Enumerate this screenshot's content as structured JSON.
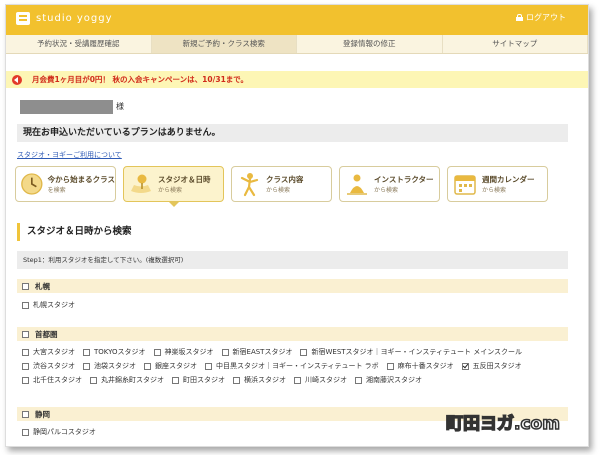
{
  "header": {
    "brand": "studio yoggy",
    "logout_label": "ログアウト"
  },
  "nav": {
    "items": [
      {
        "label": "予約状況・受講履歴確認"
      },
      {
        "label": "新規ご予約・クラス検索"
      },
      {
        "label": "登録情報の修正"
      },
      {
        "label": "サイトマップ"
      }
    ]
  },
  "promo": {
    "text": "月会費1ヶ月目が0円！ 秋の入会キャンペーンは、10/31まで。"
  },
  "user": {
    "honorific": "様"
  },
  "status": {
    "no_plan": "現在お申込いただいているプランはありません。"
  },
  "guide_link": "スタジオ・ヨギーご利用について",
  "search_tabs": [
    {
      "title": "今から始まるクラス",
      "sub": "を検索"
    },
    {
      "title": "スタジオ＆日時",
      "sub": "から検索"
    },
    {
      "title": "クラス内容",
      "sub": "から検索"
    },
    {
      "title": "インストラクター",
      "sub": "から検索"
    },
    {
      "title": "週間カレンダー",
      "sub": "から検索"
    }
  ],
  "section": {
    "title": "スタジオ＆日時から検索",
    "step1": "Step1：利用スタジオを指定して下さい。(複数選択可)"
  },
  "regions": [
    {
      "name": "札幌",
      "studios": [
        {
          "label": "札幌スタジオ",
          "checked": false
        }
      ]
    },
    {
      "name": "首都圏",
      "studios": [
        {
          "label": "大宮スタジオ",
          "checked": false
        },
        {
          "label": "TOKYOスタジオ",
          "checked": false
        },
        {
          "label": "神楽坂スタジオ",
          "checked": false
        },
        {
          "label": "新宿EASTスタジオ",
          "checked": false
        },
        {
          "label": "新宿WESTスタジオ｜ヨギー・インスティテュート メインスクール",
          "checked": false
        },
        {
          "label": "渋谷スタジオ",
          "checked": false
        },
        {
          "label": "池袋スタジオ",
          "checked": false
        },
        {
          "label": "銀座スタジオ",
          "checked": false
        },
        {
          "label": "中目黒スタジオ｜ヨギー・インスティテュート ラボ",
          "checked": false
        },
        {
          "label": "麻布十番スタジオ",
          "checked": false
        },
        {
          "label": "五反田スタジオ",
          "checked": true
        },
        {
          "label": "北千住スタジオ",
          "checked": false
        },
        {
          "label": "丸井錦糸町スタジオ",
          "checked": false
        },
        {
          "label": "町田スタジオ",
          "checked": false
        },
        {
          "label": "横浜スタジオ",
          "checked": false
        },
        {
          "label": "川崎スタジオ",
          "checked": false
        },
        {
          "label": "湘南藤沢スタジオ",
          "checked": false
        }
      ]
    },
    {
      "name": "静岡",
      "studios": [
        {
          "label": "静岡パルコスタジオ",
          "checked": false
        }
      ]
    }
  ],
  "watermark": "町田ヨガ.com",
  "colors": {
    "header": "#f2c12e",
    "promo_bg": "#fdf6b5",
    "promo_text": "#d02a1a",
    "region_bg": "#faf0d2",
    "link": "#2e5ab5"
  }
}
